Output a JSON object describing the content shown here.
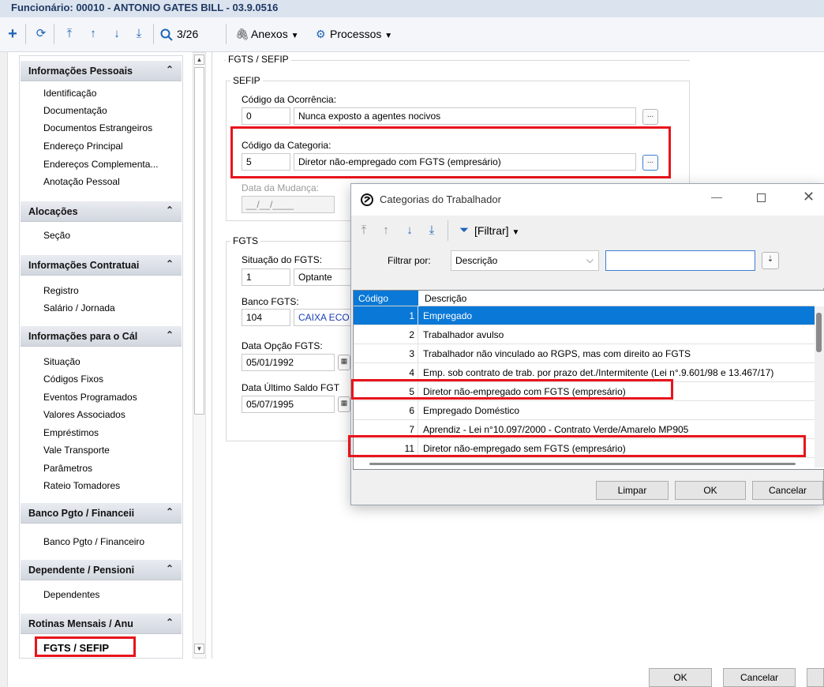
{
  "window": {
    "title": "Funcionário: 00010 - ANTONIO GATES BILL - 03.9.0516"
  },
  "toolbar": {
    "add_icon": "plus-icon",
    "refresh_icon": "refresh-icon",
    "record_counter": "3/26",
    "attachments_label": "Anexos",
    "processes_label": "Processos"
  },
  "sidebar": {
    "sections": [
      {
        "title": "Informações Pessoais",
        "items": [
          "Identificação",
          "Documentação",
          "Documentos Estrangeiros",
          "Endereço Principal",
          "Endereços Complementa...",
          "Anotação Pessoal"
        ]
      },
      {
        "title": "Alocações",
        "items": [
          "Seção"
        ]
      },
      {
        "title": "Informações Contratuai",
        "items": [
          "Registro",
          "Salário / Jornada"
        ]
      },
      {
        "title": "Informações para o Cál",
        "items": [
          "Situação",
          "Códigos Fixos",
          "Eventos Programados",
          "Valores Associados",
          "Empréstimos",
          "Vale Transporte",
          "Parâmetros",
          "Rateio Tomadores"
        ]
      },
      {
        "title": "Banco Pgto / Financeii",
        "items": [
          "Banco Pgto / Financeiro"
        ]
      },
      {
        "title": "Dependente / Pensioni",
        "items": [
          "Dependentes"
        ]
      },
      {
        "title": "Rotinas Mensais / Anu",
        "items": [
          "FGTS / SEFIP"
        ]
      }
    ]
  },
  "form": {
    "page_title": "FGTS / SEFIP",
    "sefip": {
      "legend": "SEFIP",
      "ocorrencia_label": "Código da Ocorrência:",
      "ocorrencia_code": "0",
      "ocorrencia_desc": "Nunca exposto a agentes nocivos",
      "categoria_label": "Código da Categoria:",
      "categoria_code": "5",
      "categoria_desc": "Diretor não-empregado com FGTS (empresário)",
      "mudanca_label": "Data da Mudança:",
      "mudanca_value": "__/__/____"
    },
    "fgts": {
      "legend": "FGTS",
      "situacao_label": "Situação do FGTS:",
      "situacao_code": "1",
      "situacao_desc": "Optante",
      "banco_label": "Banco FGTS:",
      "banco_code": "104",
      "banco_desc": "CAIXA ECO",
      "opcao_label": "Data Opção FGTS:",
      "opcao_value": "05/01/1992",
      "ultimo_label": "Data Último Saldo FGT",
      "ultimo_value": "05/07/1995"
    },
    "lookup_label": "...",
    "ok_label": "OK",
    "cancel_label": "Cancelar"
  },
  "dialog": {
    "title": "Categorias do Trabalhador",
    "filter_button": "[Filtrar]",
    "filter_by_label": "Filtrar por:",
    "filter_by_value": "Descrição",
    "filter_text": "",
    "columns": [
      "Código",
      "Descrição"
    ],
    "rows": [
      {
        "code": "1",
        "desc": "Empregado"
      },
      {
        "code": "2",
        "desc": "Trabalhador avulso"
      },
      {
        "code": "3",
        "desc": "Trabalhador não vinculado ao RGPS, mas com direito ao FGTS"
      },
      {
        "code": "4",
        "desc": "Emp. sob contrato de trab. por prazo det./Intermitente (Lei n°.9.601/98 e 13.467/17)"
      },
      {
        "code": "5",
        "desc": "Diretor não-empregado com FGTS (empresário)"
      },
      {
        "code": "6",
        "desc": "Empregado Doméstico"
      },
      {
        "code": "7",
        "desc": "Aprendiz - Lei n°10.097/2000 - Contrato Verde/Amarelo MP905"
      },
      {
        "code": "11",
        "desc": "Diretor não-empregado sem FGTS (empresário)"
      }
    ],
    "selected_index": 0,
    "clear_label": "Limpar",
    "ok_label": "OK",
    "cancel_label": "Cancelar"
  },
  "colors": {
    "selection": "#0a78d7",
    "highlight": "#e8141c",
    "toolbar_icon": "#1e63b8"
  }
}
